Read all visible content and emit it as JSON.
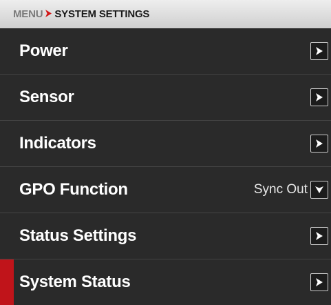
{
  "breadcrumb": {
    "root": "MENU",
    "current": "SYSTEM SETTINGS"
  },
  "icons": {
    "separator": "red-chevron-right",
    "row_action": "chevron-right-icon",
    "dropdown": "chevron-down-icon"
  },
  "colors": {
    "selected_accent": "#c0141a",
    "breadcrumb_separator": "#d11818"
  },
  "menu": {
    "selected_item": "System Status",
    "items": [
      {
        "label": "Power"
      },
      {
        "label": "Sensor"
      },
      {
        "label": "Indicators"
      },
      {
        "label": "GPO Function",
        "value": "Sync Out"
      },
      {
        "label": "Status Settings"
      },
      {
        "label": "System Status"
      }
    ]
  }
}
